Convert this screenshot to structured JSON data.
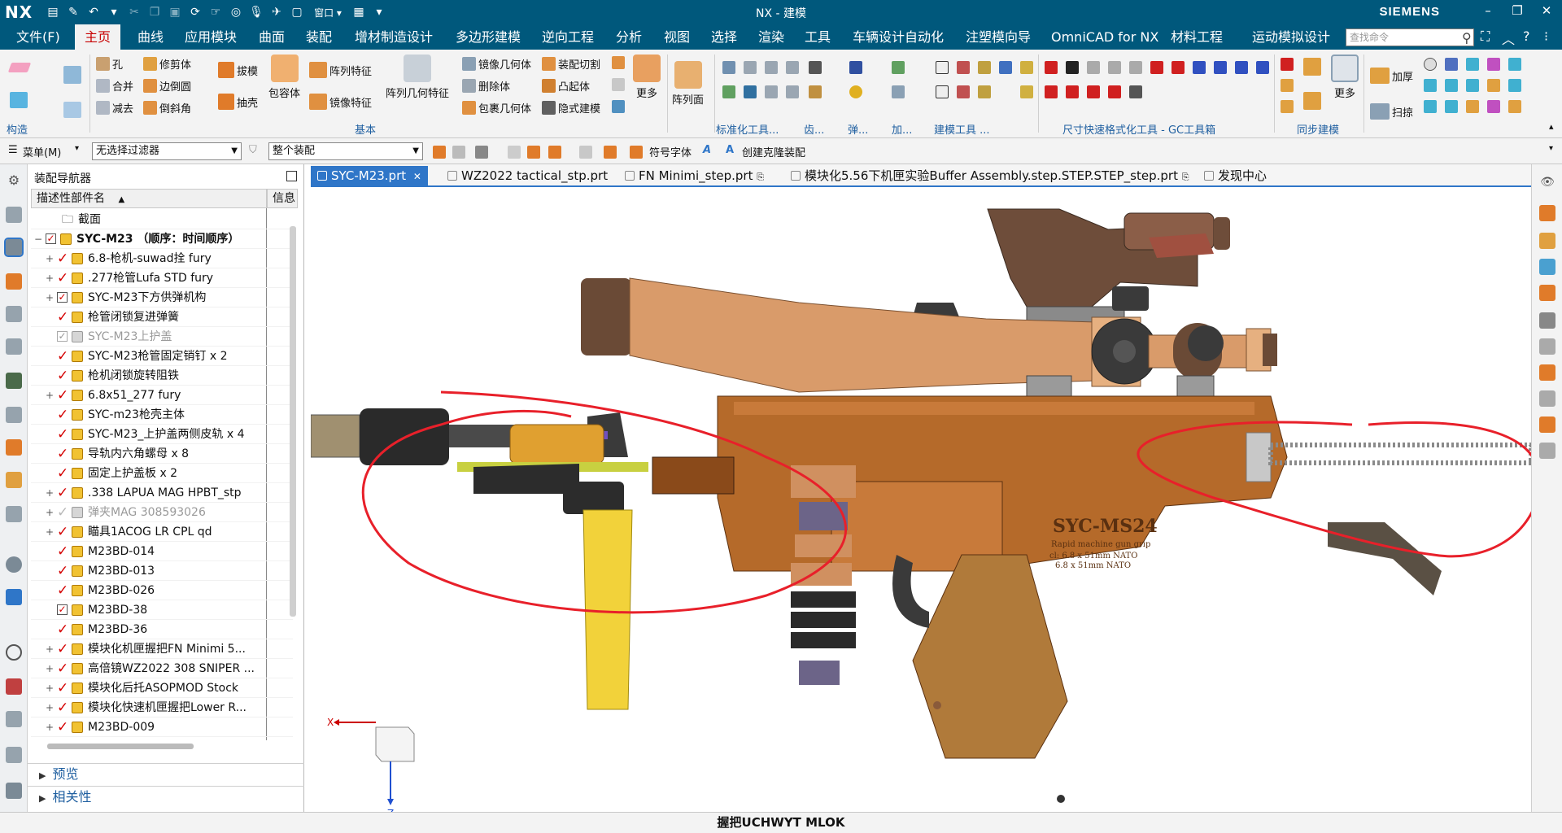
{
  "titlebar": {
    "logo": "NX",
    "title": "NX - 建模",
    "brand": "SIEMENS"
  },
  "menubar": {
    "items": [
      "文件(F)",
      "主页",
      "曲线",
      "应用模块",
      "曲面",
      "装配",
      "增材制造设计",
      "多边形建模",
      "逆向工程",
      "分析",
      "视图",
      "选择",
      "渲染",
      "工具",
      "车辆设计自动化",
      "注塑模向导",
      "OmniCAD for NX",
      "材料工程",
      "运动模拟设计"
    ],
    "active_index": 1,
    "search_placeholder": "查找命令"
  },
  "ribbon": {
    "groups": {
      "construct": "构造",
      "basic": "基本",
      "standardize": "标准化工具...",
      "gear": "齿...",
      "spring": "弹...",
      "add": "加...",
      "modeling_tools": "建模工具 ...",
      "dim": "尺寸快速格式化工具 - GC工具箱",
      "sync": "同步建模"
    },
    "buttons": {
      "hole": "孔",
      "trim": "修剪体",
      "unite": "合并",
      "edge_blend": "边倒圆",
      "subtract": "减去",
      "chamfer": "倒斜角",
      "draft": "拔模",
      "shell": "抽壳",
      "enclose": "包容体",
      "pattern_feature": "阵列特征",
      "mirror_feature": "镜像特征",
      "pattern_geometry": "阵列几何特征",
      "mirror_geometry": "镜像几何体",
      "delete_body": "删除体",
      "wrap_geometry": "包裹几何体",
      "assembly_cut": "装配切割",
      "emboss": "凸起体",
      "implicit_model": "隐式建模",
      "more": "更多",
      "pattern_face": "阵列面",
      "sync_more": "更多",
      "thicken": "加厚",
      "sweep": "扫掠"
    }
  },
  "toolbar": {
    "menu_label": "菜单(M)",
    "filter_value": "无选择过滤器",
    "scope_value": "整个装配",
    "symbol_font": "符号字体",
    "clone_assembly": "创建克隆装配"
  },
  "navigator": {
    "title": "装配导航器",
    "col_name": "描述性部件名",
    "col_info": "信息",
    "section_node": "截面",
    "rows": [
      {
        "label": "SYC-M23 （顺序：时间顺序）",
        "level": 0,
        "expand": "−",
        "check": "box",
        "bold": true,
        "dim": false
      },
      {
        "label": "6.8-枪机-suwad拴 fury",
        "level": 1,
        "expand": "+",
        "check": "tick",
        "bold": false,
        "dim": false
      },
      {
        "label": ".277枪管Lufa STD fury",
        "level": 1,
        "expand": "+",
        "check": "tick",
        "bold": false,
        "dim": false
      },
      {
        "label": "SYC-M23下方供弹机构",
        "level": 1,
        "expand": "+",
        "check": "box",
        "bold": false,
        "dim": false
      },
      {
        "label": "枪管闭锁复进弹簧",
        "level": 1,
        "expand": "",
        "check": "tick",
        "bold": false,
        "dim": false
      },
      {
        "label": "SYC-M23上护盖",
        "level": 1,
        "expand": "",
        "check": "boxempty",
        "bold": false,
        "dim": true
      },
      {
        "label": "SYC-M23枪管固定销钉 x 2",
        "level": 1,
        "expand": "",
        "check": "tick",
        "bold": false,
        "dim": false
      },
      {
        "label": "枪机闭锁旋转阻铁",
        "level": 1,
        "expand": "",
        "check": "tick",
        "bold": false,
        "dim": false
      },
      {
        "label": "6.8x51_277 fury",
        "level": 1,
        "expand": "+",
        "check": "tick",
        "bold": false,
        "dim": false
      },
      {
        "label": "SYC-m23枪壳主体",
        "level": 1,
        "expand": "",
        "check": "tick",
        "bold": false,
        "dim": false
      },
      {
        "label": "SYC-M23_上护盖两侧皮轨 x 4",
        "level": 1,
        "expand": "",
        "check": "tick",
        "bold": false,
        "dim": false
      },
      {
        "label": "导轨内六角螺母 x 8",
        "level": 1,
        "expand": "",
        "check": "tick",
        "bold": false,
        "dim": false
      },
      {
        "label": "固定上护盖板 x 2",
        "level": 1,
        "expand": "",
        "check": "tick",
        "bold": false,
        "dim": false
      },
      {
        "label": ".338 LAPUA MAG HPBT_stp",
        "level": 1,
        "expand": "+",
        "check": "tick",
        "bold": false,
        "dim": false
      },
      {
        "label": "弹夹MAG 308593026",
        "level": 1,
        "expand": "+",
        "check": "tick",
        "bold": false,
        "dim": true
      },
      {
        "label": "瞄具1ACOG LR CPL qd",
        "level": 1,
        "expand": "+",
        "check": "tick",
        "bold": false,
        "dim": false
      },
      {
        "label": "M23BD-014",
        "level": 1,
        "expand": "",
        "check": "tick",
        "bold": false,
        "dim": false
      },
      {
        "label": "M23BD-013",
        "level": 1,
        "expand": "",
        "check": "tick",
        "bold": false,
        "dim": false
      },
      {
        "label": "M23BD-026",
        "level": 1,
        "expand": "",
        "check": "tick",
        "bold": false,
        "dim": false
      },
      {
        "label": "M23BD-38",
        "level": 1,
        "expand": "",
        "check": "box",
        "bold": false,
        "dim": false
      },
      {
        "label": "M23BD-36",
        "level": 1,
        "expand": "",
        "check": "tick",
        "bold": false,
        "dim": false
      },
      {
        "label": "模块化机匣握把FN Minimi 5...",
        "level": 1,
        "expand": "+",
        "check": "tick",
        "bold": false,
        "dim": false
      },
      {
        "label": "高倍镜WZ2022 308 SNIPER ...",
        "level": 1,
        "expand": "+",
        "check": "tick",
        "bold": false,
        "dim": false
      },
      {
        "label": "模块化后托ASOPMOD Stock",
        "level": 1,
        "expand": "+",
        "check": "tick",
        "bold": false,
        "dim": false
      },
      {
        "label": "模块化快速机匣握把Lower R...",
        "level": 1,
        "expand": "+",
        "check": "tick",
        "bold": false,
        "dim": false
      },
      {
        "label": "M23BD-009",
        "level": 1,
        "expand": "+",
        "check": "tick",
        "bold": false,
        "dim": false
      }
    ],
    "preview": "预览",
    "relations": "相关性"
  },
  "tabs": [
    {
      "label": "SYC-M23.prt",
      "active": true
    },
    {
      "label": "WZ2022 tactical_stp.prt",
      "active": false
    },
    {
      "label": "FN Minimi_step.prt",
      "active": false
    },
    {
      "label": "模块化5.56下机匣实验Buffer Assembly.step.STEP.STEP_step.prt",
      "active": false
    },
    {
      "label": "发现中心",
      "active": false
    }
  ],
  "viewport": {
    "engraving_title": "SYC-MS24",
    "engraving_sub": "Rapid machine gun grip",
    "engraving_cal": "cl:  6.8 x 51mm  NATO",
    "engraving_cal2": "6.8 x 51mm  NATO",
    "axis_x": "X",
    "axis_z": "Z"
  },
  "status": {
    "text": "握把UCHWYT MLOK"
  },
  "colors": {
    "nx_blue": "#00587c",
    "tab_blue": "#2f76c8",
    "annotation_red": "#e8202a",
    "receiver_bronze": "#b56a2a",
    "scope_tan": "#d99b6a"
  }
}
